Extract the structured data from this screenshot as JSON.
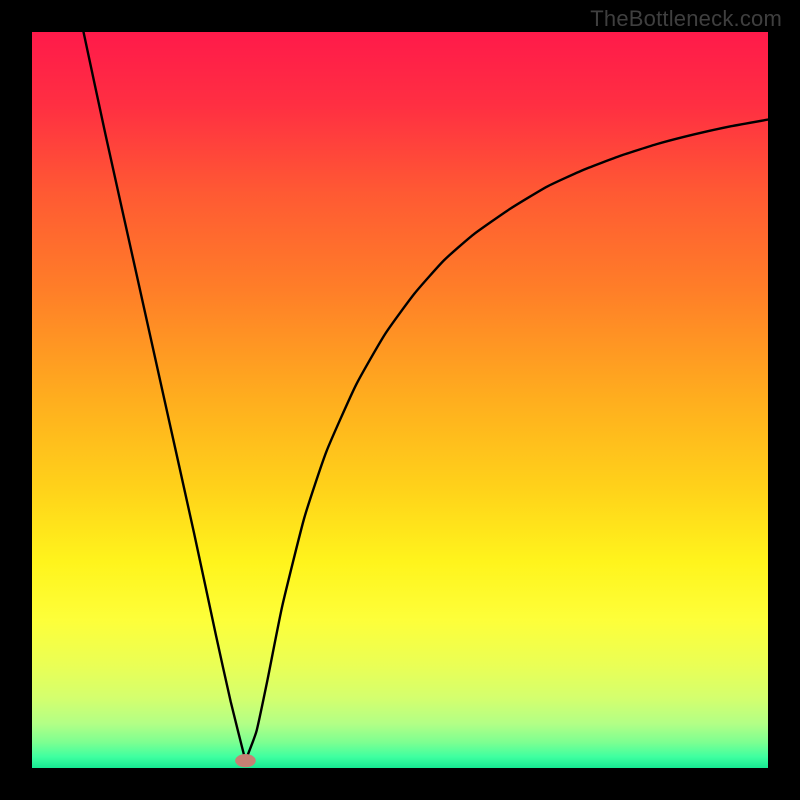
{
  "watermark": "TheBottleneck.com",
  "colors": {
    "frame": "#000000",
    "curve": "#000000",
    "marker_fill": "#c78074",
    "gradient_stops": [
      {
        "offset": 0.0,
        "color": "#ff1a4a"
      },
      {
        "offset": 0.1,
        "color": "#ff2f42"
      },
      {
        "offset": 0.22,
        "color": "#ff5a33"
      },
      {
        "offset": 0.35,
        "color": "#ff7e28"
      },
      {
        "offset": 0.5,
        "color": "#ffae1e"
      },
      {
        "offset": 0.62,
        "color": "#ffd21a"
      },
      {
        "offset": 0.72,
        "color": "#fff41c"
      },
      {
        "offset": 0.8,
        "color": "#fdff3a"
      },
      {
        "offset": 0.86,
        "color": "#eaff55"
      },
      {
        "offset": 0.905,
        "color": "#d4ff6e"
      },
      {
        "offset": 0.94,
        "color": "#b2ff86"
      },
      {
        "offset": 0.965,
        "color": "#7dff91"
      },
      {
        "offset": 0.985,
        "color": "#3effa0"
      },
      {
        "offset": 1.0,
        "color": "#16e892"
      }
    ]
  },
  "chart_data": {
    "type": "line",
    "title": "",
    "xlabel": "",
    "ylabel": "",
    "xlim": [
      0,
      100
    ],
    "ylim": [
      0,
      100
    ],
    "legend": false,
    "grid": false,
    "series": [
      {
        "name": "left-segment",
        "x": [
          7,
          10,
          14,
          18,
          22,
          25,
          27,
          29
        ],
        "y": [
          100,
          86,
          68,
          50,
          32,
          18,
          9,
          1
        ]
      },
      {
        "name": "right-segment",
        "x": [
          29,
          30.5,
          32,
          34,
          37,
          40,
          44,
          48,
          52,
          56,
          60,
          65,
          70,
          75,
          80,
          85,
          90,
          95,
          100
        ],
        "y": [
          1,
          5,
          12,
          22,
          34,
          43,
          52,
          59,
          64.5,
          69,
          72.5,
          76,
          79,
          81.3,
          83.2,
          84.8,
          86.1,
          87.2,
          88.1
        ]
      }
    ],
    "marker": {
      "x": 29,
      "y": 1,
      "rx": 1.4,
      "ry": 0.9
    },
    "annotations": []
  }
}
